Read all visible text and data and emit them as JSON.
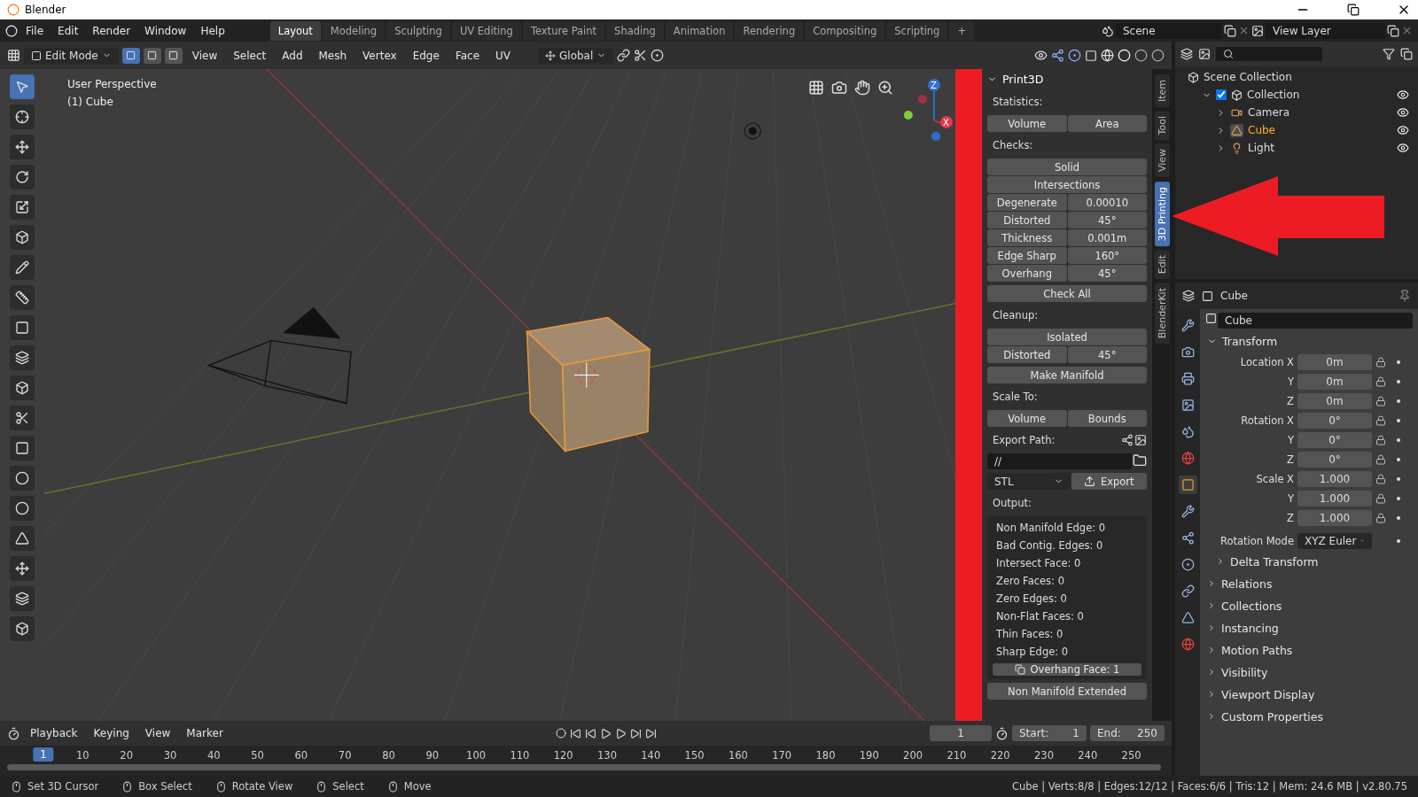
{
  "window": {
    "title": "Blender"
  },
  "menu": [
    "File",
    "Edit",
    "Render",
    "Window",
    "Help"
  ],
  "workspaces": [
    {
      "label": "Layout",
      "selected": true
    },
    {
      "label": "Modeling",
      "selected": false
    },
    {
      "label": "Sculpting",
      "selected": false
    },
    {
      "label": "UV Editing",
      "selected": false
    },
    {
      "label": "Texture Paint",
      "selected": false
    },
    {
      "label": "Shading",
      "selected": false
    },
    {
      "label": "Animation",
      "selected": false
    },
    {
      "label": "Rendering",
      "selected": false
    },
    {
      "label": "Compositing",
      "selected": false
    },
    {
      "label": "Scripting",
      "selected": false
    },
    {
      "label": "+",
      "selected": false
    }
  ],
  "scene": "Scene",
  "view_layer": "View Layer",
  "header": {
    "mode": "Edit Mode",
    "select_modes": [
      {
        "selected": true
      },
      {
        "selected": false
      },
      {
        "selected": false
      }
    ],
    "menus": [
      "View",
      "Select",
      "Add",
      "Mesh",
      "Vertex",
      "Edge",
      "Face",
      "UV"
    ],
    "orientation": "Global"
  },
  "viewport": {
    "title": "User Perspective",
    "object": "(1) Cube",
    "axes": [
      "Z",
      "X"
    ]
  },
  "print3d": {
    "title": "Print3D",
    "items": [
      {
        "kind": "heading",
        "text": "Statistics:"
      },
      {
        "kind": "buttons",
        "labels": [
          "Volume",
          "Area"
        ]
      },
      {
        "kind": "heading",
        "text": "Checks:"
      },
      {
        "kind": "group",
        "rows": [
          {
            "label": "Solid"
          },
          {
            "label": "Intersections"
          },
          {
            "label": "Degenerate",
            "value": "0.00010"
          },
          {
            "label": "Distorted",
            "value": "45°"
          },
          {
            "label": "Thickness",
            "value": "0.001m"
          },
          {
            "label": "Edge Sharp",
            "value": "160°"
          },
          {
            "label": "Overhang",
            "value": "45°"
          }
        ]
      },
      {
        "kind": "button",
        "label": "Check All"
      },
      {
        "kind": "heading",
        "text": "Cleanup:"
      },
      {
        "kind": "group",
        "rows": [
          {
            "label": "Isolated"
          },
          {
            "label": "Distorted",
            "value": "45°"
          }
        ]
      },
      {
        "kind": "button",
        "label": "Make Manifold"
      },
      {
        "kind": "heading",
        "text": "Scale To:"
      },
      {
        "kind": "buttons",
        "labels": [
          "Volume",
          "Bounds"
        ]
      },
      {
        "kind": "export_path",
        "label": "Export Path:",
        "path": "//"
      },
      {
        "kind": "export",
        "format": "STL",
        "button": "Export"
      },
      {
        "kind": "heading",
        "text": "Output:"
      },
      {
        "kind": "output",
        "lines": [
          "Non Manifold Edge: 0",
          "Bad Contig. Edges: 0",
          "Intersect Face: 0",
          "Zero Faces: 0",
          "Zero Edges: 0",
          "Non-Flat Faces: 0",
          "Thin Faces: 0",
          "Sharp Edge: 0"
        ],
        "button": "Overhang Face: 1"
      },
      {
        "kind": "button",
        "label": "Non Manifold Extended"
      }
    ]
  },
  "sidebar_tabs": [
    {
      "label": "Item",
      "selected": false
    },
    {
      "label": "Tool",
      "selected": false
    },
    {
      "label": "View",
      "selected": false
    },
    {
      "label": "3D Printing",
      "selected": true
    },
    {
      "label": "Edit",
      "selected": false
    },
    {
      "label": "BlenderKit",
      "selected": false
    }
  ],
  "outliner": {
    "tree": [
      {
        "label": "Scene Collection",
        "children": [
          {
            "label": "Collection",
            "checked": true,
            "expanded": true,
            "children": [
              {
                "label": "Camera",
                "kind": "camera",
                "selected": false
              },
              {
                "label": "Cube",
                "kind": "mesh",
                "selected": true
              },
              {
                "label": "Light",
                "kind": "light",
                "selected": false
              }
            ]
          }
        ]
      }
    ]
  },
  "properties": {
    "header": "Cube",
    "name": "Cube",
    "transform": {
      "title": "Transform",
      "expanded": true,
      "rows": [
        {
          "label": "Location X",
          "value": "0m"
        },
        {
          "label": "Y",
          "value": "0m"
        },
        {
          "label": "Z",
          "value": "0m"
        },
        {
          "label": "Rotation X",
          "value": "0°"
        },
        {
          "label": "Y",
          "value": "0°"
        },
        {
          "label": "Z",
          "value": "0°"
        },
        {
          "label": "Scale X",
          "value": "1.000"
        },
        {
          "label": "Y",
          "value": "1.000"
        },
        {
          "label": "Z",
          "value": "1.000"
        }
      ],
      "rotation_mode": {
        "label": "Rotation Mode",
        "value": "XYZ Euler"
      },
      "sub": "Delta Transform"
    },
    "panels": [
      "Relations",
      "Collections",
      "Instancing",
      "Motion Paths",
      "Visibility",
      "Viewport Display",
      "Custom Properties"
    ]
  },
  "timeline": {
    "menus": [
      "Playback",
      "Keying",
      "View",
      "Marker"
    ],
    "current": "1",
    "start_label": "Start:",
    "start": "1",
    "end_label": "End:",
    "end": "250",
    "marker": "1",
    "ticks": [
      "10",
      "20",
      "30",
      "40",
      "50",
      "60",
      "70",
      "80",
      "90",
      "100",
      "110",
      "120",
      "130",
      "140",
      "150",
      "160",
      "170",
      "180",
      "190",
      "200",
      "210",
      "220",
      "230",
      "240",
      "250"
    ]
  },
  "status_bar": {
    "hints": [
      "Set 3D Cursor",
      "Box Select",
      "Rotate View",
      "Select",
      "Move"
    ],
    "stats": "Cube | Verts:8/8 | Edges:12/12 | Faces:6/6 | Tris:12 | Mem: 24.6 MB | v2.80.75"
  }
}
